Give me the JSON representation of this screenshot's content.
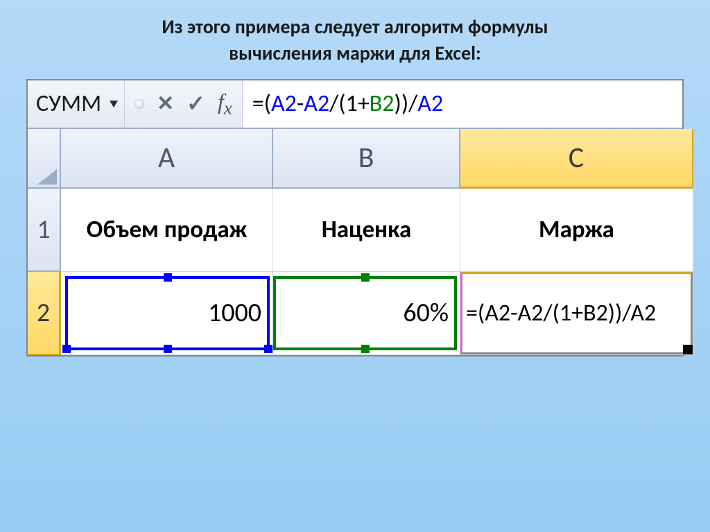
{
  "title_line1": "Из этого примера следует алгоритм формулы",
  "title_line2": "вычисления маржи для Excel:",
  "formula_bar": {
    "name_box": "СУММ",
    "formula_parts": {
      "p1": "=(",
      "p2": "A2",
      "p3": "-",
      "p4": "A2",
      "p5": "/(1+",
      "p6": "B2",
      "p7": "))/",
      "p8": "A2"
    }
  },
  "columns": {
    "a": "A",
    "b": "B",
    "c": "C"
  },
  "rows": {
    "r1": "1",
    "r2": "2"
  },
  "cells": {
    "a1": "Объем продаж",
    "b1": "Наценка",
    "c1": "Маржа",
    "a2": "1000",
    "b2": "60%",
    "c2": "=(A2-A2/(1+B2))/A2"
  }
}
